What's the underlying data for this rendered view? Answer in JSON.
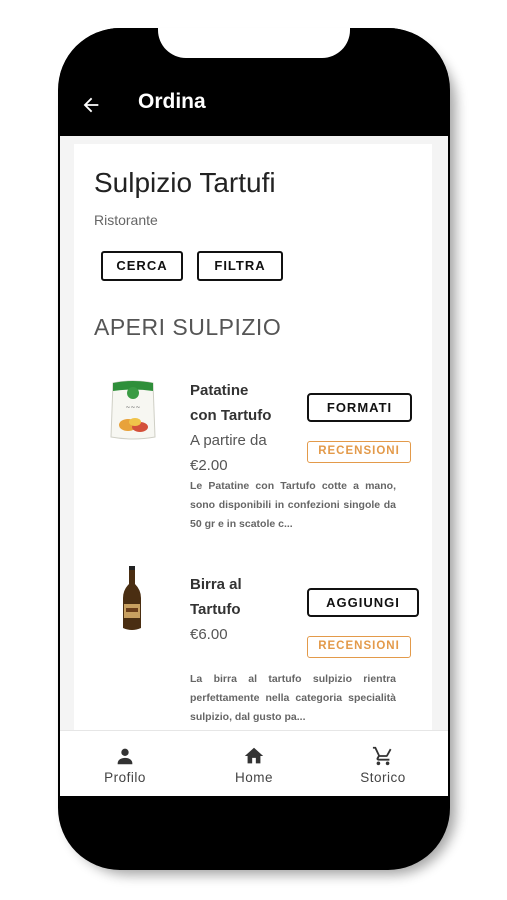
{
  "appbar": {
    "title": "Ordina",
    "back_icon": "arrow-left-icon"
  },
  "shop": {
    "name": "Sulpizio Tartufi",
    "type": "Ristorante"
  },
  "actions": {
    "search_label": "CERCA",
    "filter_label": "FILTRA"
  },
  "section": {
    "title": "APERI SULPIZIO"
  },
  "products": [
    {
      "name_line1": "Patatine",
      "name_line2": "con Tartufo",
      "price_line1": "A partire da",
      "price_line2": "€2.00",
      "description": "Le Patatine con Tartufo cotte a mano, sono disponibili in confezioni singole da 50 gr e in scatole c...",
      "primary_action": "FORMATI",
      "review_action": "RECENSIONI",
      "image_icon": "chips-bag-image"
    },
    {
      "name_line1": "Birra al",
      "name_line2": "Tartufo",
      "price_line1": "€6.00",
      "description": "La birra al tartufo sulpizio rientra perfettamente nella categoria specialità sulpizio, dal gusto pa...",
      "primary_action": "AGGIUNGI",
      "review_action": "RECENSIONI",
      "image_icon": "beer-bottle-image"
    }
  ],
  "bottom_nav": [
    {
      "label": "Profilo",
      "icon": "person-icon"
    },
    {
      "label": "Home",
      "icon": "home-icon"
    },
    {
      "label": "Storico",
      "icon": "cart-icon"
    }
  ],
  "colors": {
    "appbar": "#000000",
    "review_accent": "#e39a4a",
    "background": "#f4f4f4"
  }
}
